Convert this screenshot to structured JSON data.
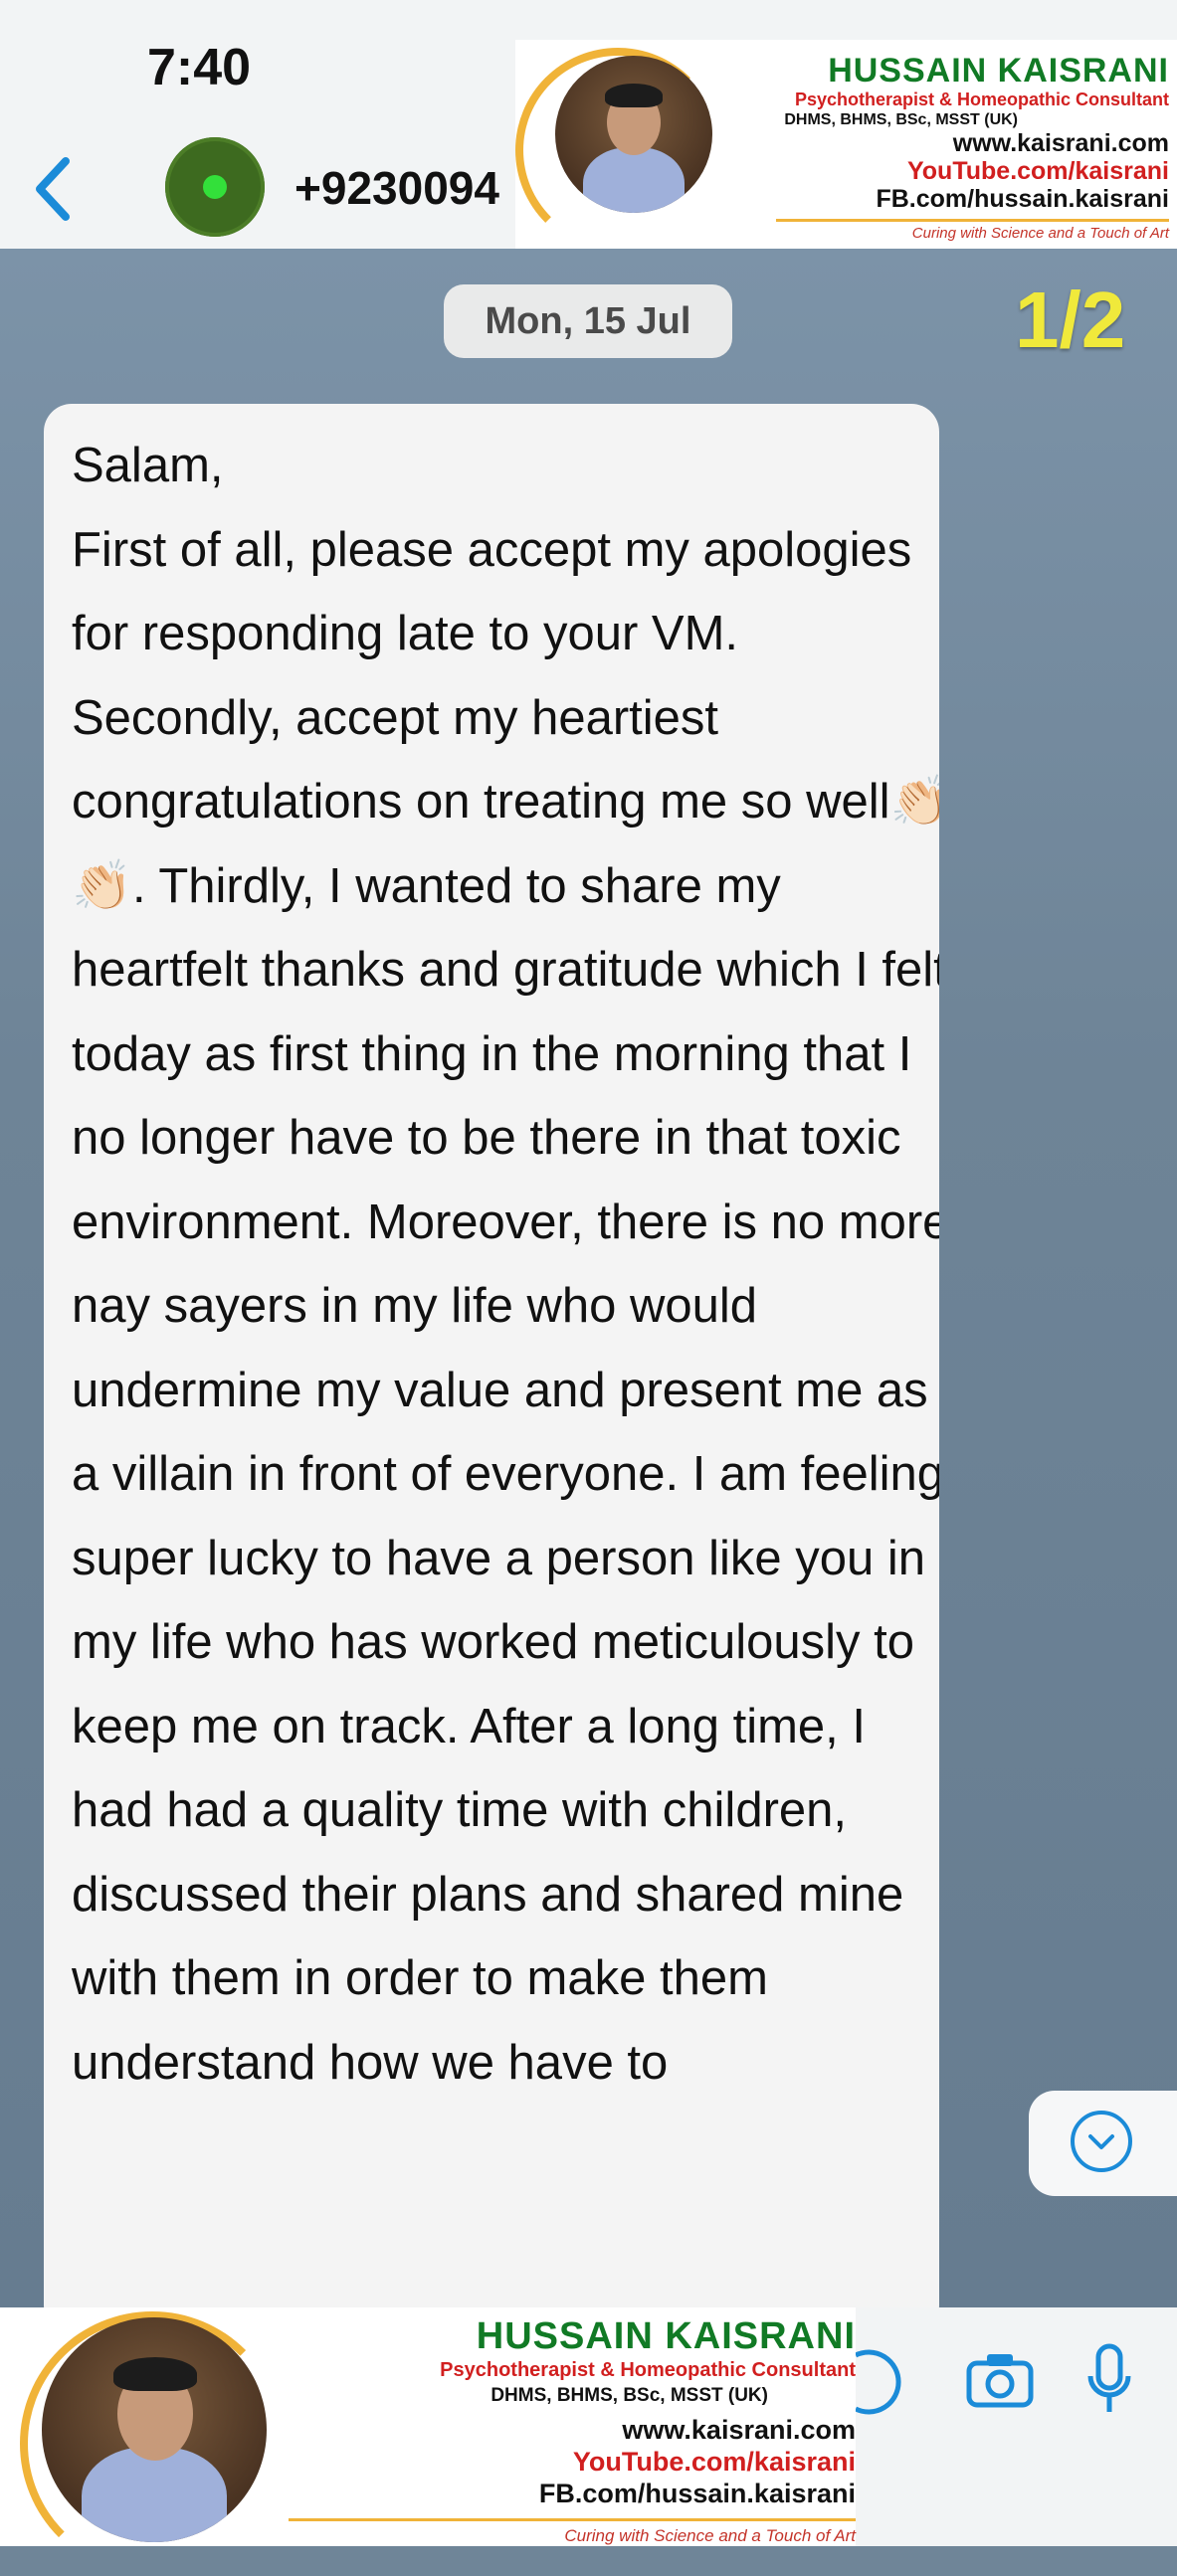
{
  "status_bar": {
    "time": "7:40"
  },
  "header": {
    "contact_name": "+9230094"
  },
  "branding": {
    "name": "HUSSAIN KAISRANI",
    "subtitle": "Psychotherapist & Homeopathic Consultant",
    "qualifications": "DHMS, BHMS, BSc, MSST (UK)",
    "website": "www.kaisrani.com",
    "youtube": "YouTube.com/kaisrani",
    "facebook": "FB.com/hussain.kaisrani",
    "tagline": "Curing with Science and a Touch of Art"
  },
  "chat": {
    "date_chip": "Mon, 15 Jul",
    "page_counter": "1/2",
    "message": "Salam,\nFirst of all, please accept my apologies for responding late to your VM. Secondly, accept my heartiest congratulations on treating me so well👏🏻👏🏻. Thirdly, I wanted to share my heartfelt thanks and gratitude which I felt today as first thing in the morning that I no longer have to be there in that toxic environment. Moreover, there is no more nay sayers in my life who would undermine my value and present me as a villain in front of everyone. I am feeling super lucky to have a person like you in my life who has worked meticulously to keep me on track. After a long time, I had had a quality time with children, discussed their plans and shared mine with them in order to make them understand how we have to"
  },
  "colors": {
    "accent_blue": "#1b8bd8",
    "brand_green": "#117a25",
    "brand_red": "#d11f1f",
    "counter_yellow": "#f0e93b"
  }
}
